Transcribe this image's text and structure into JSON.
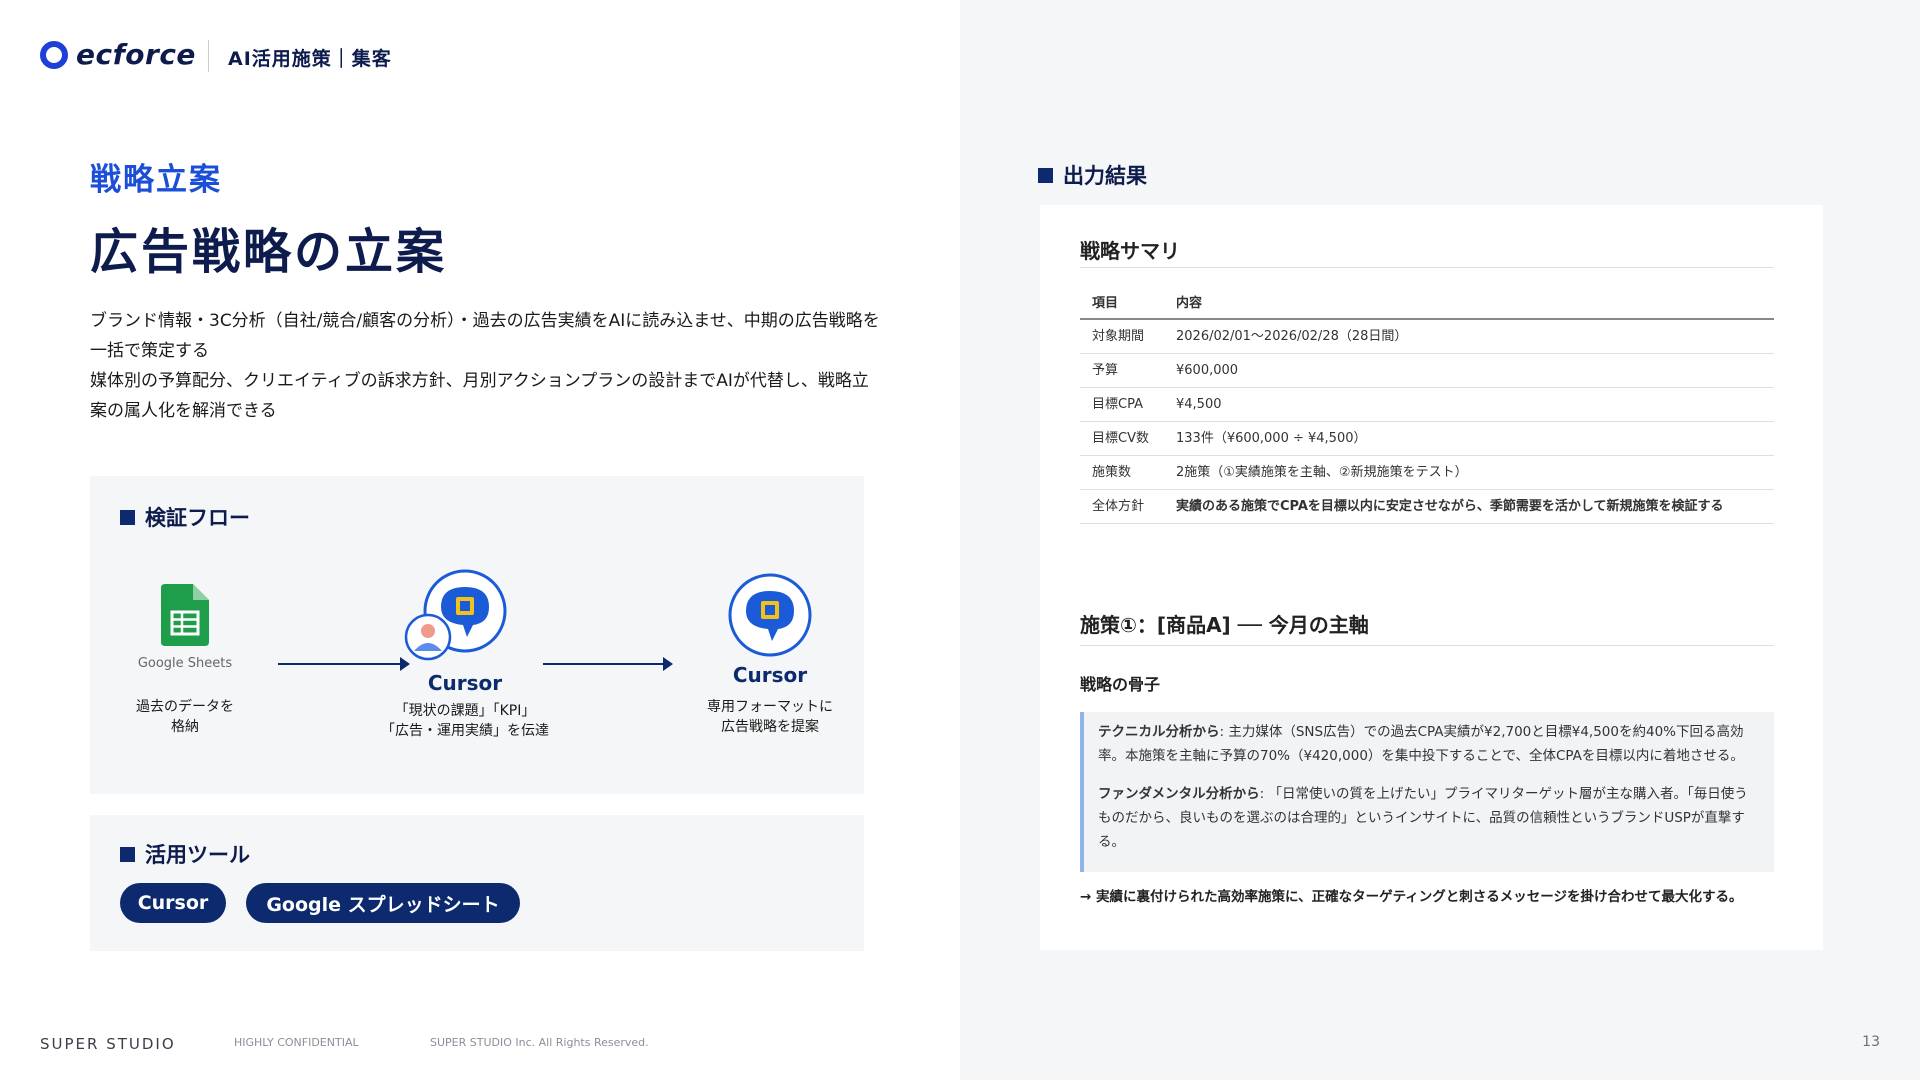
{
  "header": {
    "logo_text": "ecforce",
    "breadcrumb": "AI活用施策｜集客"
  },
  "hero": {
    "eyebrow": "戦略立案",
    "title": "広告戦略の立案",
    "description": [
      "ブランド情報・3C分析（自社/競合/顧客の分析）・過去の広告実績をAIに読み込ませ、中期の広告戦略を一括で策定する",
      "媒体別の予算配分、クリエイティブの訴求方針、月別アクションプランの設計までAIが代替し、戦略立案の属人化を解消できる"
    ]
  },
  "flow": {
    "title": "検証フロー",
    "steps": [
      {
        "icon_caption": "Google Sheets",
        "label_lines": [
          "過去のデータを",
          "格納"
        ]
      },
      {
        "name": "Cursor",
        "label_lines": [
          "「現状の課題」「KPI」",
          "「広告・運用実績」を伝達"
        ]
      },
      {
        "name": "Cursor",
        "label_lines": [
          "専用フォーマットに",
          "広告戦略を提案"
        ]
      }
    ]
  },
  "tools": {
    "title": "活用ツール",
    "items": [
      "Cursor",
      "Google スプレッドシート"
    ]
  },
  "output": {
    "title": "出力結果",
    "summary_title": "戦略サマリ",
    "table_headers": [
      "項目",
      "内容"
    ],
    "rows": [
      {
        "key": "対象期間",
        "value": "2026/02/01〜2026/02/28（28日間）"
      },
      {
        "key": "予算",
        "value": "¥600,000"
      },
      {
        "key": "目標CPA",
        "value": "¥4,500"
      },
      {
        "key": "目標CV数",
        "value": "133件（¥600,000 ÷ ¥4,500）"
      },
      {
        "key": "施策数",
        "value": "2施策（①実績施策を主軸、②新規施策をテスト）"
      },
      {
        "key": "全体方針",
        "value": "実績のある施策でCPAを目標以内に安定させながら、季節需要を活かして新規施策を検証する"
      }
    ],
    "section_title": "施策①：[商品A] ── 今月の主軸",
    "subsection_title": "戦略の骨子",
    "quote": [
      {
        "lead": "テクニカル分析から",
        "text": ": 主力媒体（SNS広告）での過去CPA実績が¥2,700と目標¥4,500を約40%下回る高効率。本施策を主軸に予算の70%（¥420,000）を集中投下することで、全体CPAを目標以内に着地させる。"
      },
      {
        "lead": "ファンダメンタル分析から",
        "text": ": 「日常使いの質を上げたい」プライマリターゲット層が主な購入者。「毎日使うものだから、良いものを選ぶのは合理的」というインサイトに、品質の信頼性というブランドUSPが直撃する。"
      }
    ],
    "conclusion": "→ 実績に裏付けられた高効率施策に、正確なターゲティングと刺さるメッセージを掛け合わせて最大化する。"
  },
  "footer": {
    "brand": "SUPER STUDIO",
    "confidential": "HIGHLY CONFIDENTIAL",
    "copyright": "SUPER STUDIO Inc. All Rights Reserved.",
    "page_number": "13"
  },
  "colors": {
    "navy": "#0d2a6e",
    "accent_blue": "#1c4fd8",
    "sheets_green": "#1e9e4a",
    "panel_gray": "#f5f6f8"
  },
  "icons": [
    "logo-ring-icon",
    "google-sheets-icon",
    "cursor-ai-icon",
    "user-avatar-icon",
    "arrow-right-icon"
  ]
}
